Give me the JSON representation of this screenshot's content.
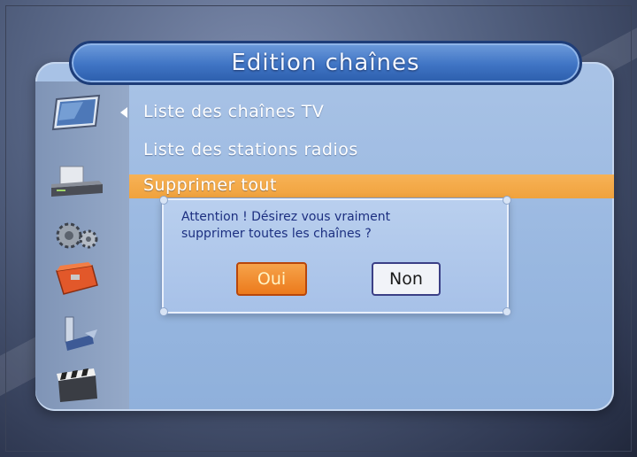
{
  "title": "Edition chaînes",
  "menu": {
    "items": [
      {
        "label": "Liste des chaînes TV"
      },
      {
        "label": "Liste des stations radios"
      },
      {
        "label": "Supprimer tout"
      }
    ]
  },
  "sidebar": {
    "icons": [
      "tv-icon",
      "receiver-icon",
      "gears-icon",
      "toolbox-icon",
      "tools-icon",
      "clapperboard-icon"
    ]
  },
  "dialog": {
    "line1": "Attention ! Désirez vous vraiment",
    "line2": "supprimer toutes les chaînes ?",
    "yes_label": "Oui",
    "no_label": "Non"
  },
  "colors": {
    "title_blue": "#3f74c4",
    "selection_orange": "#f0a23d",
    "dialog_text": "#1c2f80",
    "panel_blue": "#98b7e0"
  }
}
